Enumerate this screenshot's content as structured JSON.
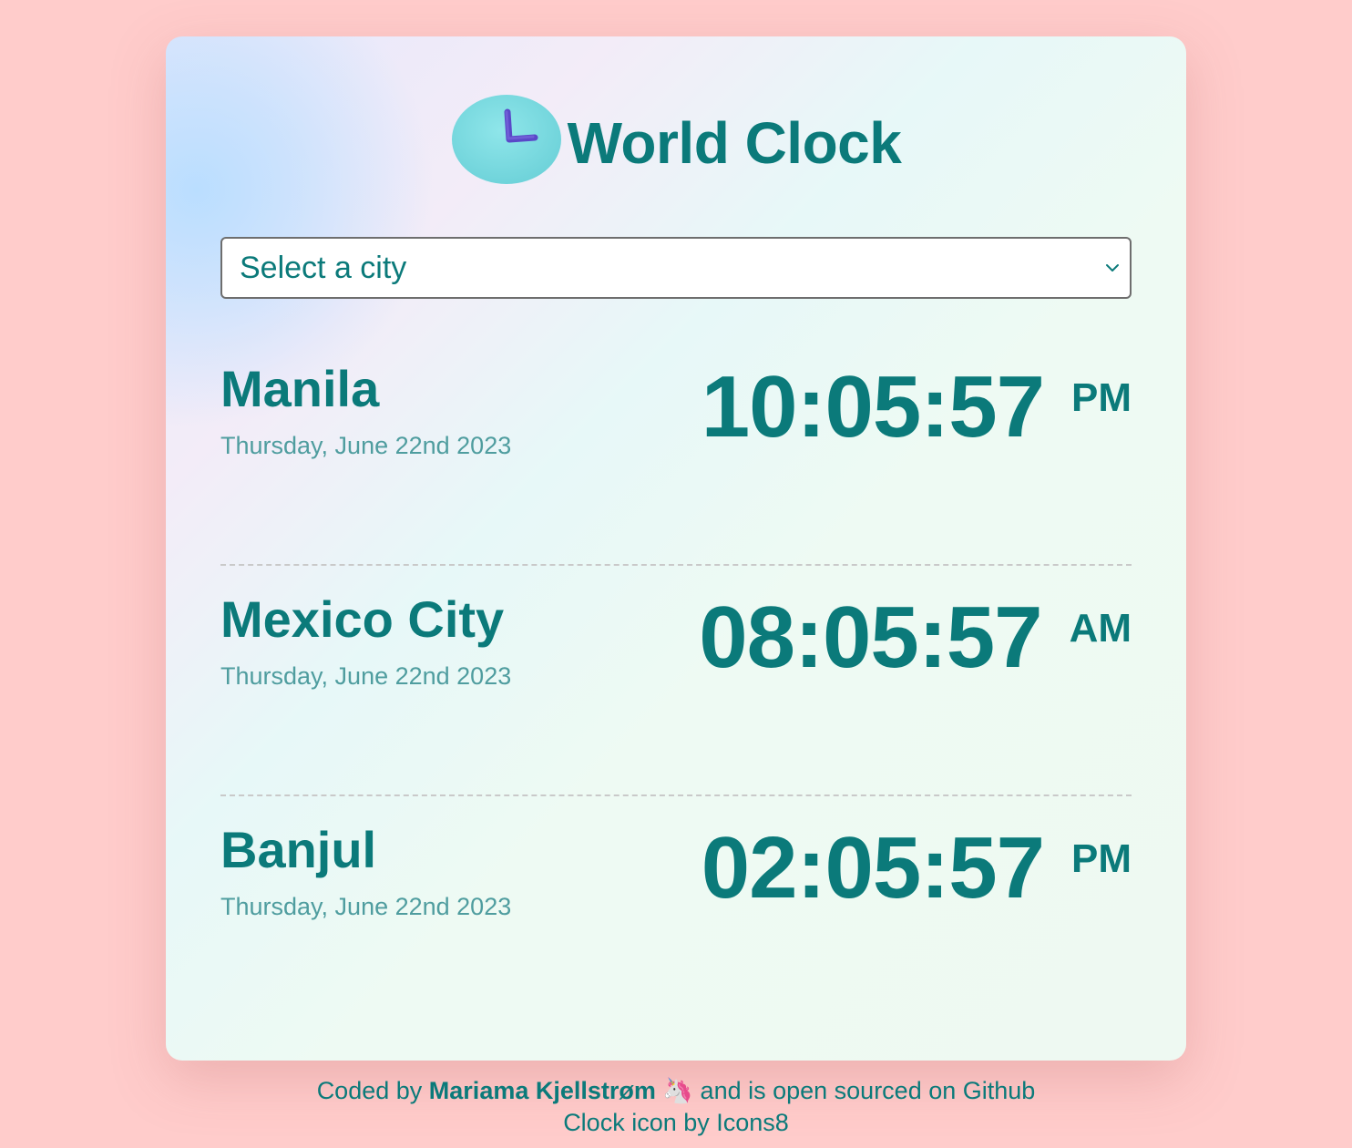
{
  "header": {
    "title": "World Clock",
    "icon": "clock-icon"
  },
  "city_select": {
    "selected": "Select a city"
  },
  "cities": [
    {
      "name": "Manila",
      "date": "Thursday, June 22nd 2023",
      "time": "10:05:57",
      "ampm": "PM"
    },
    {
      "name": "Mexico City",
      "date": "Thursday, June 22nd 2023",
      "time": "08:05:57",
      "ampm": "AM"
    },
    {
      "name": "Banjul",
      "date": "Thursday, June 22nd 2023",
      "time": "02:05:57",
      "ampm": "PM"
    }
  ],
  "footer": {
    "coded_by": "Coded by",
    "author": "Mariama Kjellstrøm",
    "emoji": "🦄",
    "open_source_text": "and is open sourced on Github",
    "credit": "Clock icon by Icons8"
  },
  "colors": {
    "background": "#ffcccb",
    "accent": "#0b7a7a",
    "date_text": "#4f9d9f"
  }
}
